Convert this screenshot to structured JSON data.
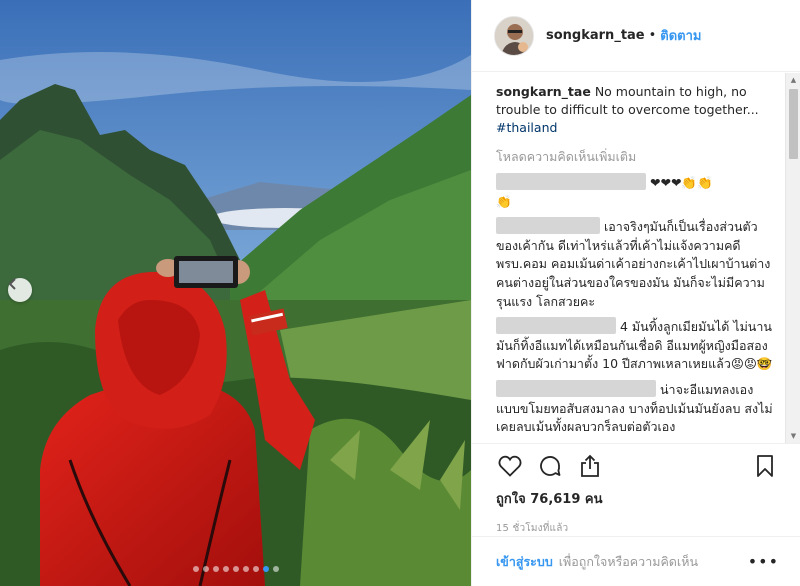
{
  "post": {
    "username": "songkarn_tae",
    "separator": "•",
    "follow_label": "ติดตาม",
    "caption_user": "songkarn_tae",
    "caption_text": "No mountain to high, no trouble to difficult to overcome together...",
    "hashtag": "#thailand",
    "load_more": "โหลดความคิดเห็นเพิ่มเติม",
    "comments": [
      {
        "text": "❤❤❤👏👏",
        "extra": "👏"
      },
      {
        "text": "เอาจริงๆมันก็เป็นเรื่องส่วนตัวของเค้ากัน ดีเท่าไหร่แล้วที่เค้าไม่แจ้งความคดี พรบ.คอม คอมเม้นด่าเค้าอย่างกะเค้าไปเผาบ้านต่างคนต่างอยู่ในส่วนของใครของมัน มันก็จะไม่มีความรุนแรง โลกสวยคะ"
      },
      {
        "text": "4 มันทิ้งลูกเมียมันได้ ไม่นานมันก็ทิ้งอีแมทได้เหมือนกันเชื่อดิ อีแมทผู้หญิงมือสอง ฟาดกับผัวเก่ามาตั้ง 10 ปีสภาพเหลาเหยแล้ว😡😡🤓"
      },
      {
        "text": "น่าจะอีแมทลงเอง แบบขโมยทอสับสงมาลง บางท็อปเม้นมันยังลบ สงไม่เคยลบเม้นทั้งผลบวกร็ลบต่อตัวเอง"
      }
    ],
    "likes_label": "ถูกใจ 76,619 คน",
    "time_label": "15 ชั่วโมงที่แล้ว",
    "login_label": "เข้าสู่ระบบ",
    "login_hint": "เพื่อถูกใจหรือความคิดเห็น",
    "more_label": "•••",
    "carousel": {
      "count": 9,
      "active_index": 7
    }
  },
  "icons": {
    "prev": "chevron-left-icon",
    "like": "heart-icon",
    "comment": "speech-bubble-icon",
    "share": "share-icon",
    "save": "bookmark-icon"
  },
  "colors": {
    "accent": "#3897f0",
    "hashtag": "#003569",
    "muted": "#999999"
  }
}
